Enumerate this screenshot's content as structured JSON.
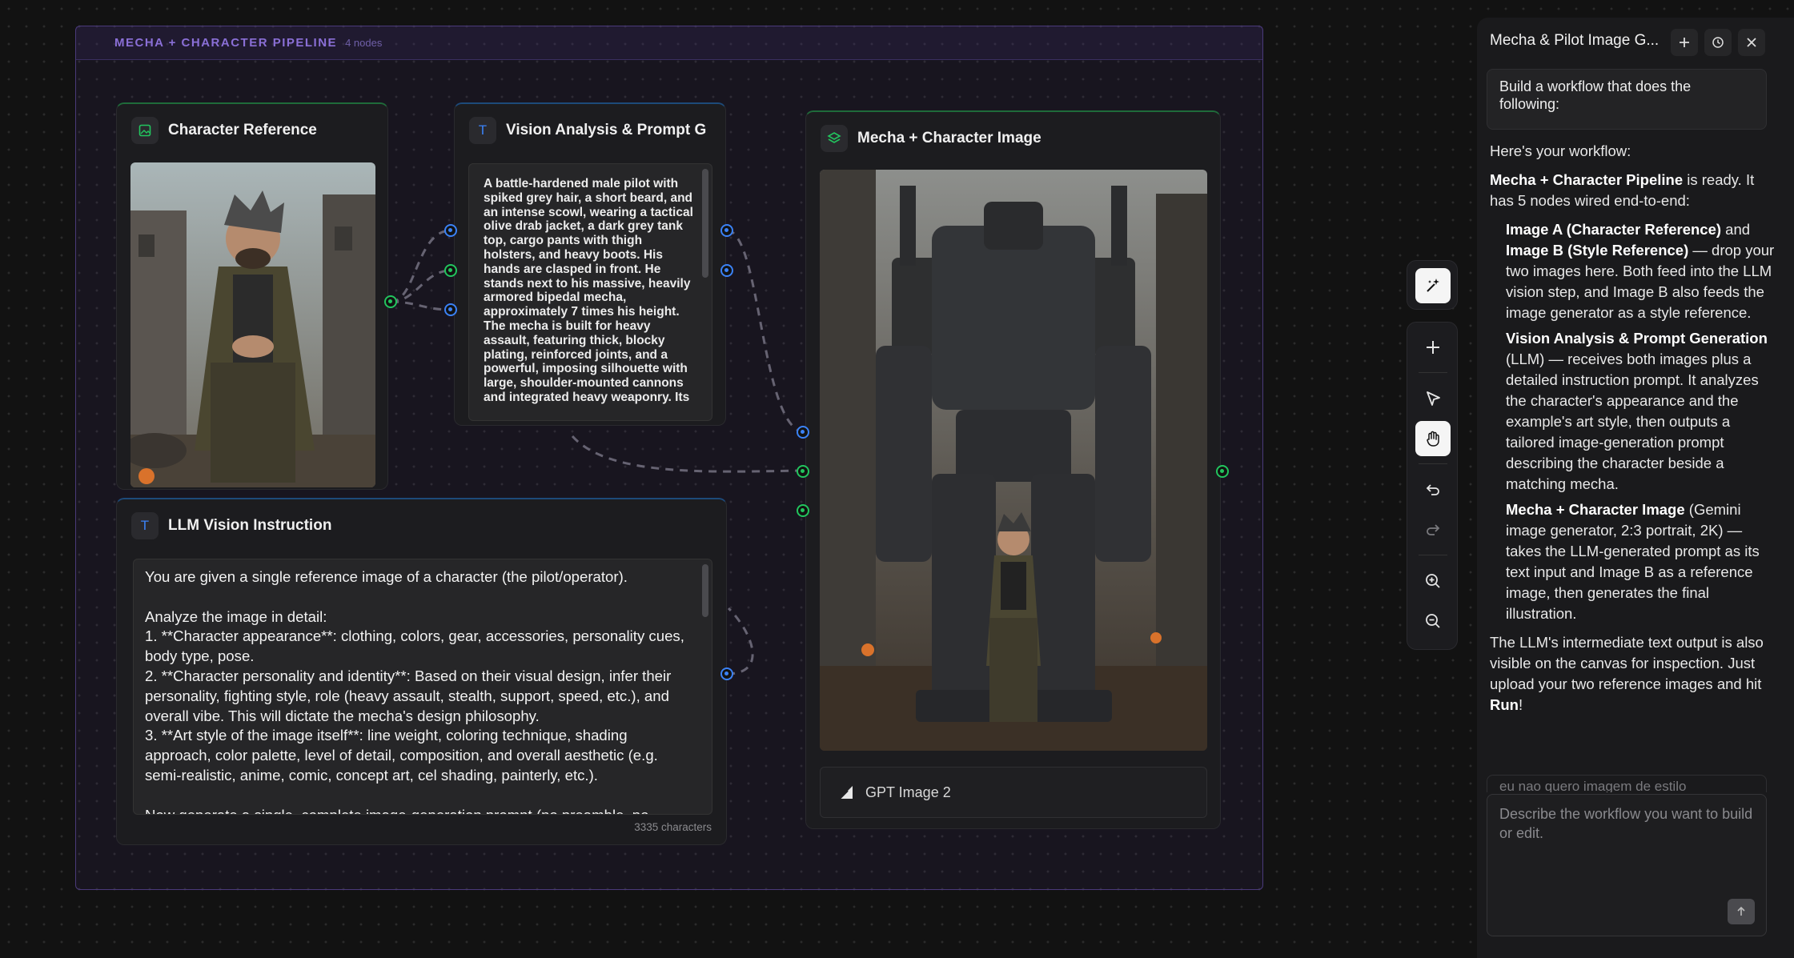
{
  "group": {
    "title": "MECHA + CHARACTER PIPELINE",
    "count": "4 nodes"
  },
  "nodes": {
    "character_reference": {
      "title": "Character Reference"
    },
    "vision_analysis": {
      "title": "Vision Analysis & Prompt G",
      "output_text": "A battle-hardened male pilot with spiked grey hair, a short beard, and an intense scowl, wearing a tactical olive drab jacket, a dark grey tank top, cargo pants with thigh holsters, and heavy boots. His hands are clasped in front. He stands next to his massive, heavily armored bipedal mecha, approximately 7 times his height. The mecha is built for heavy assault, featuring thick, blocky plating, reinforced joints, and a powerful, imposing silhouette with large, shoulder-mounted cannons and integrated heavy weaponry. Its"
    },
    "mecha_image": {
      "title": "Mecha + Character Image",
      "model_label": "GPT Image 2"
    },
    "llm_instruction": {
      "title": "LLM Vision Instruction",
      "text": "You are given a single reference image of a character (the pilot/operator).\n\nAnalyze the image in detail:\n1. **Character appearance**: clothing, colors, gear, accessories, personality cues, body type, pose.\n2. **Character personality and identity**: Based on their visual design, infer their personality, fighting style, role (heavy assault, stealth, support, speed, etc.), and overall vibe. This will dictate the mecha's design philosophy.\n3. **Art style of the image itself**: line weight, coloring technique, shading approach, color palette, level of detail, composition, and overall aesthetic (e.g. semi-realistic, anime, comic, concept art, cel shading, painterly, etc.).\n\nNow generate a single, complete image-generation prompt (no preamble, no",
      "char_count": "3335 characters"
    }
  },
  "toolbar": {
    "magic": "magic-wand",
    "add": "plus",
    "select": "pointer",
    "pan": "hand",
    "undo": "undo",
    "redo": "redo",
    "zoom_in": "zoom-in",
    "zoom_out": "zoom-out"
  },
  "chat": {
    "title": "Mecha & Pilot Image G...",
    "user_message": "Build a workflow that does the following:",
    "intro": "Here's your workflow:",
    "summary_bold": "Mecha + Character Pipeline",
    "summary_rest": " is ready. It has 5 nodes wired end-to-end:",
    "item1_bold_a": "Image A (Character Reference)",
    "item1_mid": " and ",
    "item1_bold_b": "Image B (Style Reference)",
    "item1_rest": " — drop your two images here. Both feed into the LLM vision step, and Image B also feeds the image generator as a style reference.",
    "item2_bold": "Vision Analysis & Prompt Generation",
    "item2_rest": " (LLM) — receives both images plus a detailed instruction prompt. It analyzes the character's appearance and the example's art style, then outputs a tailored image-generation prompt describing the character beside a matching mecha.",
    "item3_bold": "Mecha + Character Image",
    "item3_rest": " (Gemini image generator, 2:3 portrait, 2K) — takes the LLM-generated prompt as its text input and Image B as a reference image, then generates the final illustration.",
    "outro_pre": "The LLM's intermediate text output is also visible on the canvas for inspection. Just upload your two reference images and hit ",
    "outro_bold": "Run",
    "outro_post": "!",
    "previous_message": "eu nao quero imagem de estilo",
    "input_placeholder": "Describe the workflow you want to build or edit."
  },
  "colors": {
    "green_handle": "#22c55e",
    "blue_handle": "#3b82f6",
    "group_accent": "#8a6fd6"
  }
}
